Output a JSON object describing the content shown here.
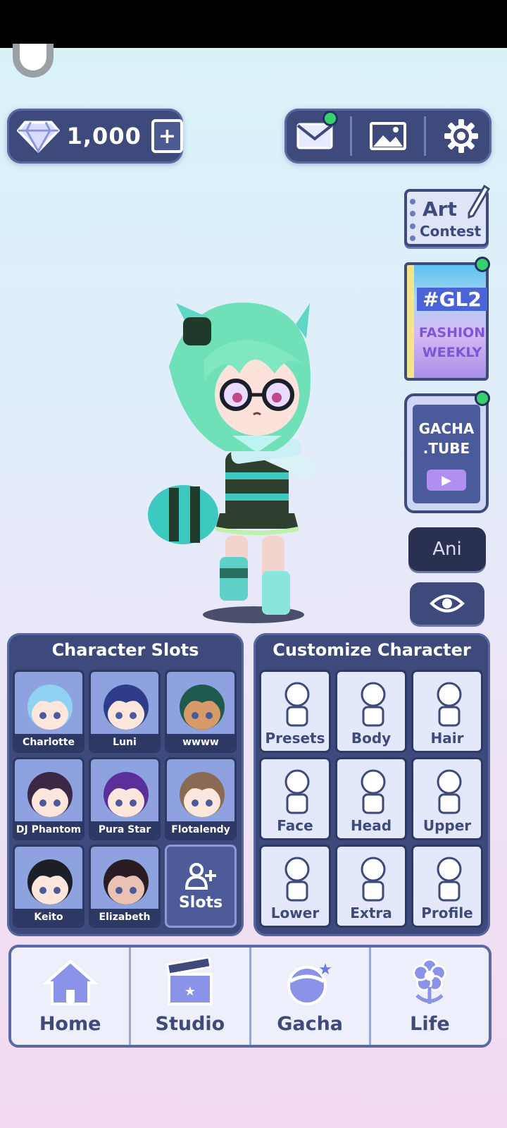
{
  "currency": {
    "gems": "1,000",
    "add_icon": "plus-box-icon"
  },
  "top_actions": [
    {
      "name": "mail",
      "icon": "mail-icon",
      "notification": true
    },
    {
      "name": "gallery",
      "icon": "image-icon",
      "notification": false
    },
    {
      "name": "settings",
      "icon": "gear-icon",
      "notification": false
    }
  ],
  "side": {
    "art_contest": {
      "line1": "Art",
      "line2": "Contest"
    },
    "fashion": {
      "tag": "#GL2",
      "line1": "FASHION",
      "line2": "WEEKLY"
    },
    "tube": {
      "line1": "GACHA",
      "line2": ".TUBE"
    },
    "ani_label": "Ani"
  },
  "character_slots": {
    "title": "Character Slots",
    "slots": [
      {
        "name": "Charlotte",
        "hair": "#8fd3f0",
        "skin": "#fde7dc"
      },
      {
        "name": "Luni",
        "hair": "#2d3d8a",
        "skin": "#fde7dc"
      },
      {
        "name": "wwww",
        "hair": "#1f5a4f",
        "skin": "#d99a6a"
      },
      {
        "name": "DJ Phantom",
        "hair": "#3a2846",
        "skin": "#fde7dc"
      },
      {
        "name": "Pura Star",
        "hair": "#5a2f9a",
        "skin": "#fde7dc"
      },
      {
        "name": "Flotalendy",
        "hair": "#8a6a52",
        "skin": "#fde7dc"
      },
      {
        "name": "Keito",
        "hair": "#1c2026",
        "skin": "#fde7dc"
      },
      {
        "name": "Elizabeth",
        "hair": "#2b1c24",
        "skin": "#e9c2b4"
      }
    ],
    "add_label": "Slots"
  },
  "customize": {
    "title": "Customize Character",
    "items": [
      {
        "label": "Presets",
        "icon": "presets-icon"
      },
      {
        "label": "Body",
        "icon": "body-icon"
      },
      {
        "label": "Hair",
        "icon": "hair-icon"
      },
      {
        "label": "Face",
        "icon": "face-icon"
      },
      {
        "label": "Head",
        "icon": "head-icon"
      },
      {
        "label": "Upper",
        "icon": "upper-icon"
      },
      {
        "label": "Lower",
        "icon": "lower-icon"
      },
      {
        "label": "Extra",
        "icon": "extra-icon"
      },
      {
        "label": "Profile",
        "icon": "profile-icon"
      }
    ]
  },
  "nav": [
    {
      "label": "Home",
      "icon": "home-icon"
    },
    {
      "label": "Studio",
      "icon": "clapperboard-icon"
    },
    {
      "label": "Gacha",
      "icon": "gacha-icon"
    },
    {
      "label": "Life",
      "icon": "flower-icon"
    }
  ],
  "colors": {
    "panel": "#3d4a7b",
    "accent_green": "#38d06a",
    "label": "#3d4a7b"
  }
}
